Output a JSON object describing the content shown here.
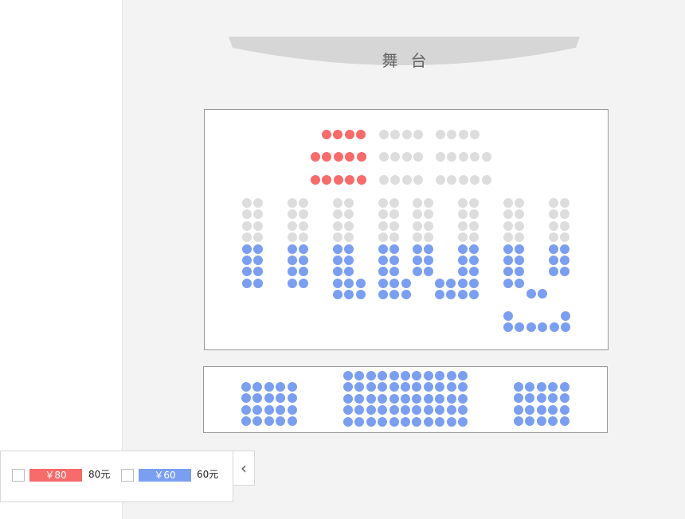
{
  "stage": {
    "label": "舞台"
  },
  "legend": {
    "items": [
      {
        "price_label": "￥80",
        "name": "80元",
        "color": "#f76b6b",
        "tier": "red",
        "checked": false
      },
      {
        "price_label": "￥60",
        "name": "60元",
        "color": "#7b9ff0",
        "tier": "blue",
        "checked": false
      }
    ],
    "collapse_icon": "chevron-left-icon",
    "collapse_glyph": "‹"
  },
  "colors": {
    "red": "#f76b6b",
    "blue": "#7b9ff0",
    "unavailable": "#dddddd",
    "background": "#f3f3f3"
  },
  "seat_map": {
    "upper_section": {
      "rows": [
        {
          "groups": [
            {
              "seats": "rrrr"
            },
            {
              "seats": "gggg"
            },
            {
              "seats": "gggg"
            }
          ]
        },
        {
          "groups": [
            {
              "seats": "rrrrr"
            },
            {
              "seats": "gggg"
            },
            {
              "seats": "ggggg"
            }
          ]
        },
        {
          "groups": [
            {
              "seats": "rrrrr"
            },
            {
              "seats": "gggg"
            },
            {
              "seats": "ggggg"
            }
          ]
        }
      ],
      "columns": [
        {
          "pattern": [
            "gg",
            "gg",
            "gg",
            "gg",
            "bb",
            "bb",
            "bb",
            "bb"
          ]
        },
        {
          "pattern": [
            "gg",
            "gg",
            "gg",
            "gg",
            "bb",
            "bb",
            "bb",
            "bb"
          ]
        },
        {
          "pattern": [
            "gg",
            "gg",
            "gg",
            "gg",
            "bb",
            "bb",
            "bb",
            "bbb",
            "bbb"
          ]
        },
        {
          "pattern": [
            "gg",
            "gg",
            "gg",
            "gg",
            "bb",
            "bb",
            "bb",
            "bbb",
            "bbb"
          ]
        },
        {
          "pattern": [
            "gg",
            "gg",
            "gg",
            "gg",
            "bb",
            "bb",
            "bb"
          ]
        },
        {
          "pattern": [
            "gg",
            "gg",
            "gg",
            "gg",
            "bb",
            "bb",
            "bb",
            "bbbb",
            "bbbb"
          ]
        },
        {
          "pattern": [
            "gg",
            "gg",
            "gg",
            "gg",
            "bb",
            "bb",
            "bb",
            "bb"
          ]
        },
        {
          "pattern": [
            "gg",
            "gg",
            "gg",
            "gg",
            "bb",
            "bb",
            "bb"
          ]
        }
      ],
      "extra_rows": [
        {
          "seats": "bb"
        },
        {
          "seats": "b"
        },
        {
          "seats": "bbbbbb"
        }
      ]
    },
    "lower_section": {
      "left": {
        "rows": 4,
        "cols": 5,
        "tier": "blue"
      },
      "center": {
        "rows": 5,
        "cols": 11,
        "tier": "blue"
      },
      "right": {
        "rows": 4,
        "cols": 5,
        "tier": "blue"
      }
    }
  }
}
